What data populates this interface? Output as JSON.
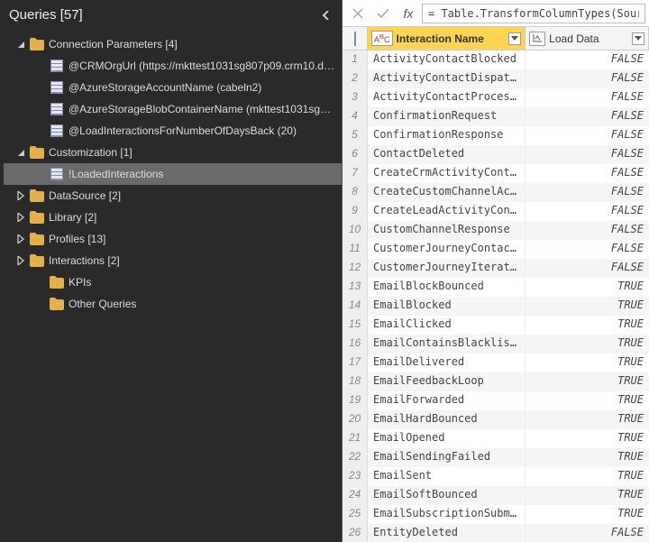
{
  "sidebar": {
    "title": "Queries [57]",
    "nodes": [
      {
        "kind": "folder",
        "expand": "open",
        "indent": 1,
        "label": "Connection Parameters [4]"
      },
      {
        "kind": "item",
        "indent": 2,
        "label": "@CRMOrgUrl (https://mkttest1031sg807p09.crm10.dy..."
      },
      {
        "kind": "item",
        "indent": 2,
        "label": "@AzureStorageAccountName (cabeln2)"
      },
      {
        "kind": "item",
        "indent": 2,
        "label": "@AzureStorageBlobContainerName (mkttest1031sg80..."
      },
      {
        "kind": "item",
        "indent": 2,
        "label": "@LoadInteractionsForNumberOfDaysBack (20)"
      },
      {
        "kind": "folder",
        "expand": "open",
        "indent": 1,
        "label": "Customization [1]"
      },
      {
        "kind": "item",
        "indent": 2,
        "label": "!LoadedInteractions",
        "selected": true
      },
      {
        "kind": "folder",
        "expand": "closed",
        "indent": 1,
        "label": "DataSource [2]"
      },
      {
        "kind": "folder",
        "expand": "closed",
        "indent": 1,
        "label": "Library [2]"
      },
      {
        "kind": "folder",
        "expand": "closed",
        "indent": 1,
        "label": "Profiles [13]"
      },
      {
        "kind": "folder",
        "expand": "closed",
        "indent": 1,
        "label": "Interactions [2]"
      },
      {
        "kind": "folder",
        "expand": "none",
        "indent": 2,
        "label": "KPIs"
      },
      {
        "kind": "folder",
        "expand": "none",
        "indent": 2,
        "label": "Other Queries"
      }
    ]
  },
  "formula": "= Table.TransformColumnTypes(Source,{{",
  "columns": {
    "col1": "Interaction Name",
    "col2": "Load Data"
  },
  "rows": [
    {
      "n": "1",
      "name": "ActivityContactBlocked",
      "load": "FALSE"
    },
    {
      "n": "2",
      "name": "ActivityContactDispatc…",
      "load": "FALSE"
    },
    {
      "n": "3",
      "name": "ActivityContactProcess…",
      "load": "FALSE"
    },
    {
      "n": "4",
      "name": "ConfirmationRequest",
      "load": "FALSE"
    },
    {
      "n": "5",
      "name": "ConfirmationResponse",
      "load": "FALSE"
    },
    {
      "n": "6",
      "name": "ContactDeleted",
      "load": "FALSE"
    },
    {
      "n": "7",
      "name": "CreateCrmActivityConta…",
      "load": "FALSE"
    },
    {
      "n": "8",
      "name": "CreateCustomChannelAct…",
      "load": "FALSE"
    },
    {
      "n": "9",
      "name": "CreateLeadActivityCont…",
      "load": "FALSE"
    },
    {
      "n": "10",
      "name": "CustomChannelResponse",
      "load": "FALSE"
    },
    {
      "n": "11",
      "name": "CustomerJourneyContact…",
      "load": "FALSE"
    },
    {
      "n": "12",
      "name": "CustomerJourneyIterati…",
      "load": "FALSE"
    },
    {
      "n": "13",
      "name": "EmailBlockBounced",
      "load": "TRUE"
    },
    {
      "n": "14",
      "name": "EmailBlocked",
      "load": "TRUE"
    },
    {
      "n": "15",
      "name": "EmailClicked",
      "load": "TRUE"
    },
    {
      "n": "16",
      "name": "EmailContainsBlacklist…",
      "load": "TRUE"
    },
    {
      "n": "17",
      "name": "EmailDelivered",
      "load": "TRUE"
    },
    {
      "n": "18",
      "name": "EmailFeedbackLoop",
      "load": "TRUE"
    },
    {
      "n": "19",
      "name": "EmailForwarded",
      "load": "TRUE"
    },
    {
      "n": "20",
      "name": "EmailHardBounced",
      "load": "TRUE"
    },
    {
      "n": "21",
      "name": "EmailOpened",
      "load": "TRUE"
    },
    {
      "n": "22",
      "name": "EmailSendingFailed",
      "load": "TRUE"
    },
    {
      "n": "23",
      "name": "EmailSent",
      "load": "TRUE"
    },
    {
      "n": "24",
      "name": "EmailSoftBounced",
      "load": "TRUE"
    },
    {
      "n": "25",
      "name": "EmailSubscriptionSubmit",
      "load": "TRUE"
    },
    {
      "n": "26",
      "name": "EntityDeleted",
      "load": "FALSE"
    }
  ]
}
